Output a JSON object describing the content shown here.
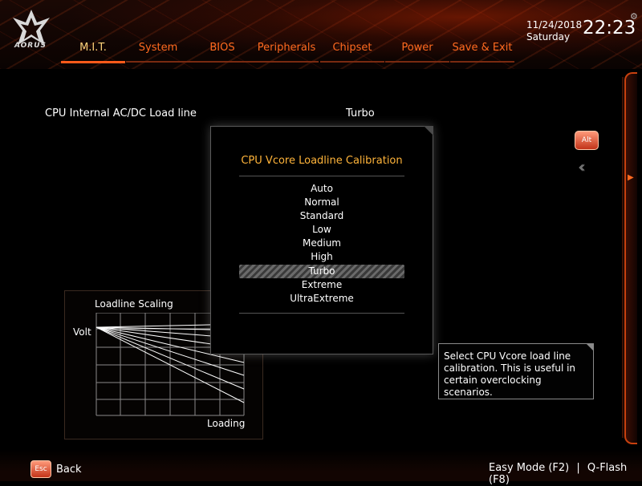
{
  "brand": {
    "logo_text": "AORUS",
    "logo_icon": "aorus-eagle-icon"
  },
  "header": {
    "tabs": [
      {
        "label": "M.I.T.",
        "active": true
      },
      {
        "label": "System"
      },
      {
        "label": "BIOS"
      },
      {
        "label": "Peripherals"
      },
      {
        "label": "Chipset"
      },
      {
        "label": "Power"
      },
      {
        "label": "Save & Exit"
      }
    ],
    "date": "11/24/2018",
    "day": "Saturday",
    "time": "22:23",
    "settings_icon": "gear-icon"
  },
  "main": {
    "setting_label": "CPU Internal AC/DC Load line",
    "setting_value": "Turbo"
  },
  "popup": {
    "title": "CPU Vcore Loadline Calibration",
    "options": [
      "Auto",
      "Normal",
      "Standard",
      "Low",
      "Medium",
      "High",
      "Turbo",
      "Extreme",
      "UltraExtreme"
    ],
    "selected": "Turbo"
  },
  "graph": {
    "title": "Loadline Scaling",
    "y_label": "Volt",
    "x_label": "Loading"
  },
  "help": {
    "text": "Select CPU Vcore load line calibration. This is useful in certain overclocking scenarios."
  },
  "sidebar": {
    "alt_label": "Alt",
    "collapse_icon": "double-chevron-left-icon"
  },
  "footer": {
    "esc_label": "Esc",
    "back_label": "Back",
    "easy_mode": "Easy Mode (F2)",
    "separator": "|",
    "qflash": "Q-Flash (F8)"
  },
  "colors": {
    "accent": "#ff6a1f",
    "title": "#ffb43a",
    "active_tab": "#ffd37a",
    "background": "#000000"
  }
}
